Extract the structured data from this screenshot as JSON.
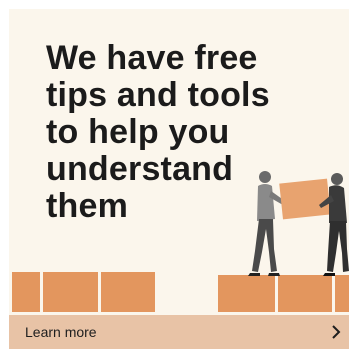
{
  "ad": {
    "headline_lines": [
      "We have free",
      "tips and tools",
      "to help you",
      "understand",
      "them"
    ],
    "cta_label": "Learn more",
    "cta_icon": "chevron-right-icon",
    "illustration": "people-carrying-box",
    "colors": {
      "background": "#fbf6ec",
      "box": "#e3965e",
      "cta_bar": "#e8c3a6",
      "text": "#1b1b1b"
    }
  }
}
